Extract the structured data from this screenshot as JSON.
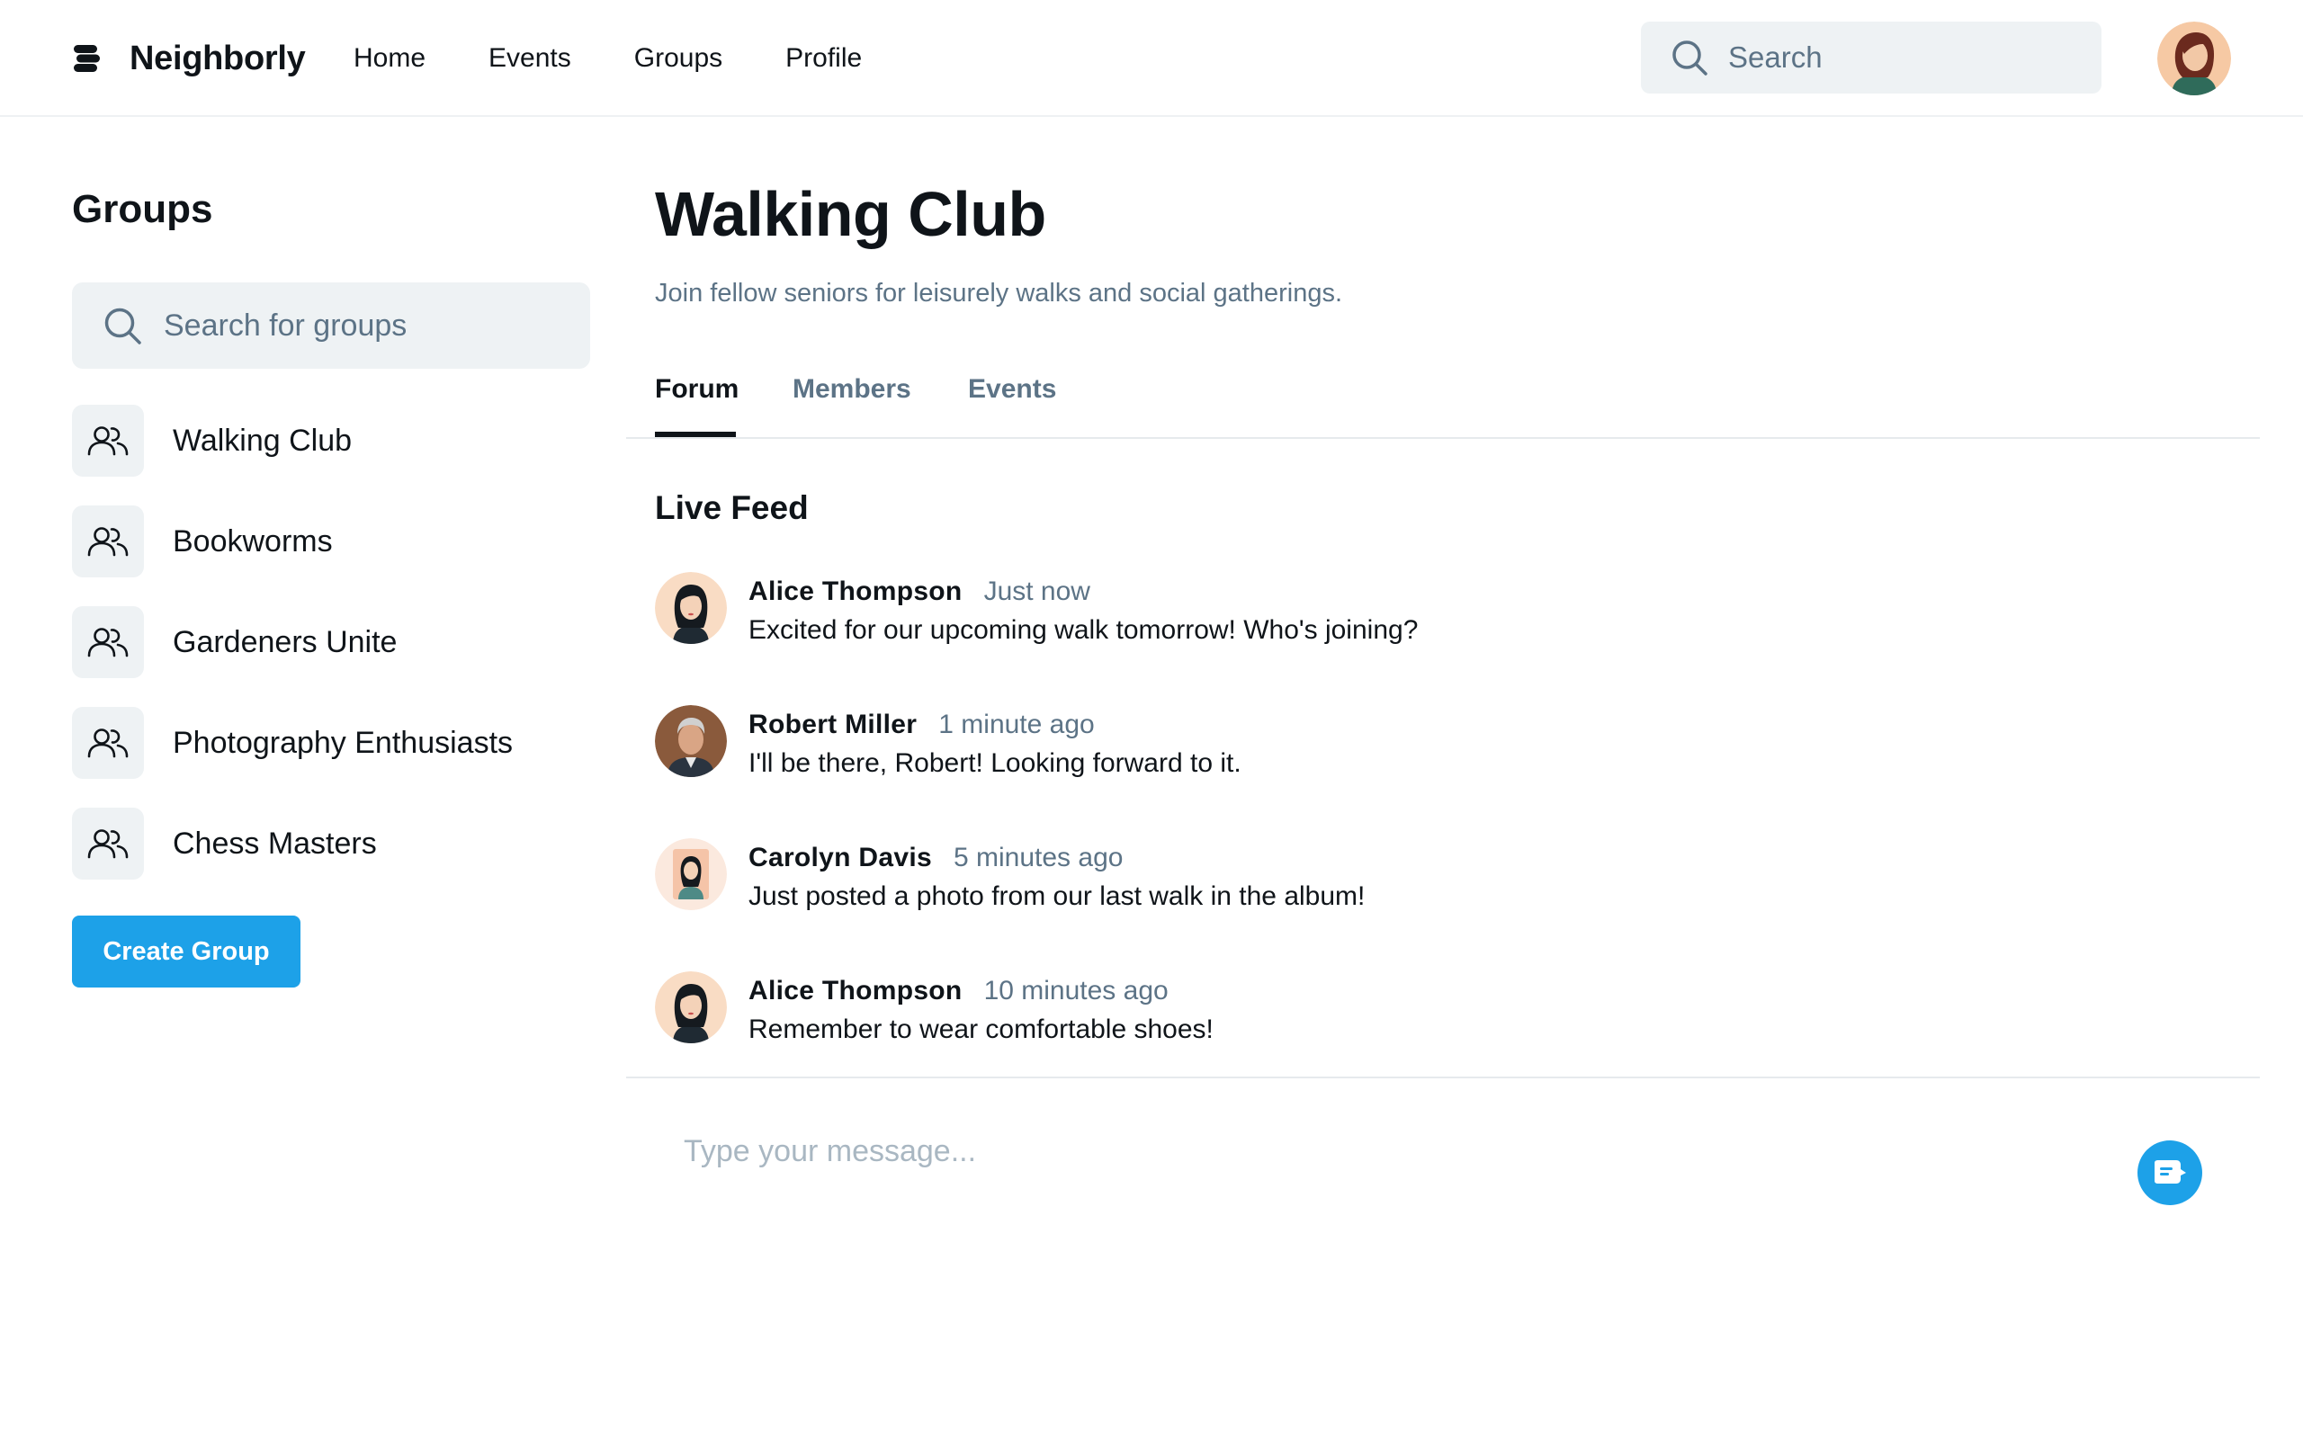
{
  "app": {
    "name": "Neighborly",
    "nav": [
      "Home",
      "Events",
      "Groups",
      "Profile"
    ],
    "search_placeholder": "Search",
    "accent_color": "#1da1e8"
  },
  "sidebar": {
    "title": "Groups",
    "search_placeholder": "Search for groups",
    "groups": [
      {
        "label": "Walking Club",
        "icon": "users-icon"
      },
      {
        "label": "Bookworms",
        "icon": "users-icon"
      },
      {
        "label": "Gardeners Unite",
        "icon": "users-icon"
      },
      {
        "label": "Photography Enthusiasts",
        "icon": "users-icon"
      },
      {
        "label": "Chess Masters",
        "icon": "users-icon"
      }
    ],
    "create_label": "Create Group"
  },
  "group": {
    "title": "Walking Club",
    "description": "Join fellow seniors for leisurely walks and social gatherings.",
    "tabs": [
      {
        "label": "Forum",
        "active": true
      },
      {
        "label": "Members",
        "active": false
      },
      {
        "label": "Events",
        "active": false
      }
    ]
  },
  "feed": {
    "title": "Live Feed",
    "posts": [
      {
        "author": "Alice Thompson",
        "time": "Just now",
        "text": "Excited for our upcoming walk tomorrow! Who's joining?"
      },
      {
        "author": "Robert Miller",
        "time": "1 minute ago",
        "text": "I'll be there, Robert! Looking forward to it."
      },
      {
        "author": "Carolyn Davis",
        "time": "5 minutes ago",
        "text": "Just posted a photo from our last walk in the album!"
      },
      {
        "author": "Alice Thompson",
        "time": "10 minutes ago",
        "text": "Remember to wear comfortable shoes!"
      }
    ]
  },
  "composer": {
    "placeholder": "Type your message..."
  }
}
